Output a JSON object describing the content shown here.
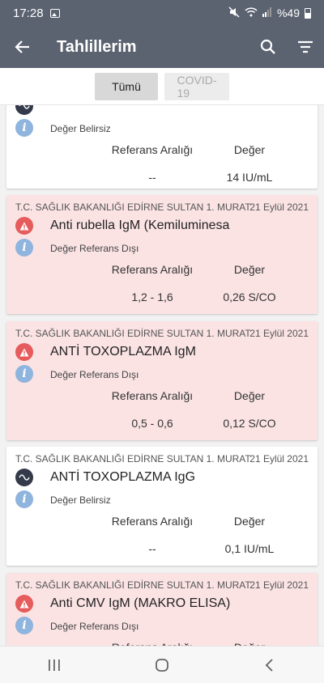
{
  "status_bar": {
    "time": "17:28",
    "battery": "%49",
    "icons": [
      "gallery-icon",
      "mute-icon",
      "wifi-icon",
      "signal-icon",
      "battery-icon"
    ]
  },
  "app_bar": {
    "title": "Tahlillerim",
    "icons": [
      "back-arrow-icon",
      "search-icon",
      "filter-icon"
    ]
  },
  "filters": [
    {
      "label": "Tümü",
      "active": true
    },
    {
      "label": "COVID-19",
      "active": false
    }
  ],
  "columns": {
    "reference": "Referans Aralığı",
    "value": "Değer"
  },
  "cards": [
    {
      "hospital": "",
      "date": "",
      "test_name": "",
      "status": "Değer Belirsiz",
      "reference": "--",
      "value": "14 IU/mL",
      "severity": "unknown"
    },
    {
      "hospital": "T.C. SAĞLIK BAKANLIĞI EDİRNE SULTAN 1. MURAT",
      "date": "21 Eylül 2021",
      "test_name": "Anti rubella IgM (Kemiluminesa",
      "status": "Değer Referans Dışı",
      "reference": "1,2 - 1,6",
      "value": "0,26 S/CO",
      "severity": "out-of-range"
    },
    {
      "hospital": "T.C. SAĞLIK BAKANLIĞI EDİRNE SULTAN 1. MURAT",
      "date": "21 Eylül 2021",
      "test_name": "ANTİ TOXOPLAZMA IgM",
      "status": "Değer Referans Dışı",
      "reference": "0,5 - 0,6",
      "value": "0,12 S/CO",
      "severity": "out-of-range"
    },
    {
      "hospital": "T.C. SAĞLIK BAKANLIĞI EDİRNE SULTAN 1. MURAT",
      "date": "21 Eylül 2021",
      "test_name": "ANTİ TOXOPLAZMA IgG",
      "status": "Değer Belirsiz",
      "reference": "--",
      "value": "0,1 IU/mL",
      "severity": "unknown"
    },
    {
      "hospital": "T.C. SAĞLIK BAKANLIĞI EDİRNE SULTAN 1. MURAT",
      "date": "21 Eylül 2021",
      "test_name": "Anti CMV IgM (MAKRO ELISA)",
      "status": "Değer Referans Dışı",
      "reference": "",
      "value": "",
      "severity": "out-of-range"
    }
  ],
  "nav_bar": {
    "icons": [
      "recent-apps-icon",
      "home-icon",
      "back-icon"
    ]
  },
  "colors": {
    "header": "#5b6270",
    "card_alert": "#fbe3e4",
    "card_normal": "#ffffff",
    "warning": "#e65b5b",
    "info": "#8fb4dd"
  }
}
